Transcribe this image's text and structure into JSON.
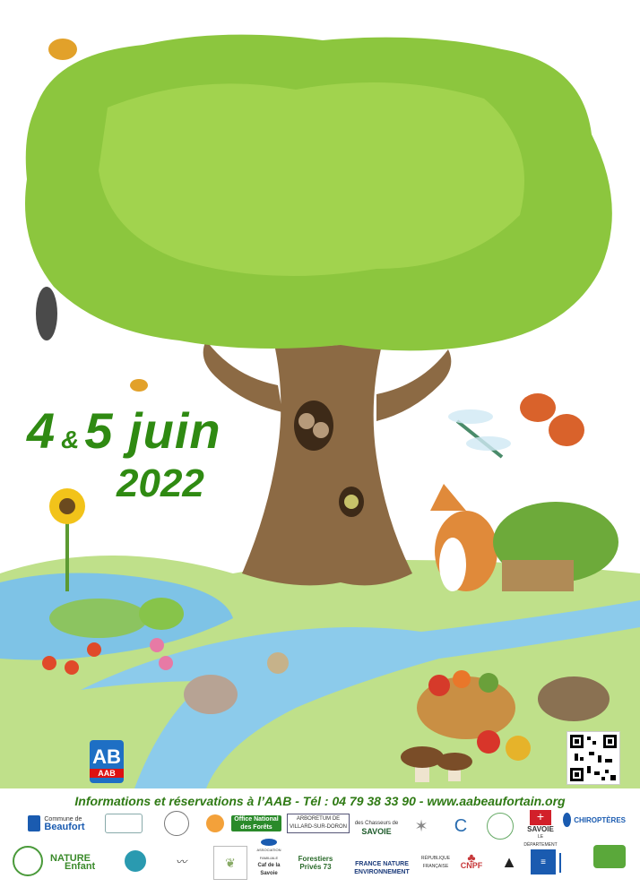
{
  "event": {
    "day1": "4",
    "amp": "&",
    "day2": "5 juin",
    "year": "2022"
  },
  "aab_logo": {
    "letters": "AB",
    "tag": "AAB"
  },
  "info_line": "Informations et réservations à l’AAB - Tél : 04 79 38 33 90 - www.aabeaufortain.org",
  "partners": {
    "beaufort_top": "Commune de",
    "beaufort_name": "Beaufort",
    "onf": "Office National des Forêts",
    "arboretum": "ARBORETUM DE VILLARD-SUR-DORON",
    "chasseurs_top": "des Chasseurs de",
    "chasseurs": "SAVOIE",
    "chiropteres": "CHIROPTÈRES",
    "savoie": "SAVOIE",
    "departement": "LE DÉPARTEMENT",
    "nature_enfant_1": "NATURE",
    "nature_enfant_2": "Enfant",
    "association_familiale": "ASSOCIATION FAMILIALE",
    "caf": "Caf de la Savoie",
    "forestiers_1": "Forestiers",
    "forestiers_2": "Privés 73",
    "france_nature_1": "FRANCE NATURE",
    "france_nature_2": "ENVIRONNEMENT",
    "cnpf": "CNPF",
    "republique": "RÉPUBLIQUE FRANÇAISE"
  },
  "colors": {
    "title_green": "#2f8a12",
    "info_green": "#2f7a14",
    "aab_blue": "#1e6fc4"
  }
}
